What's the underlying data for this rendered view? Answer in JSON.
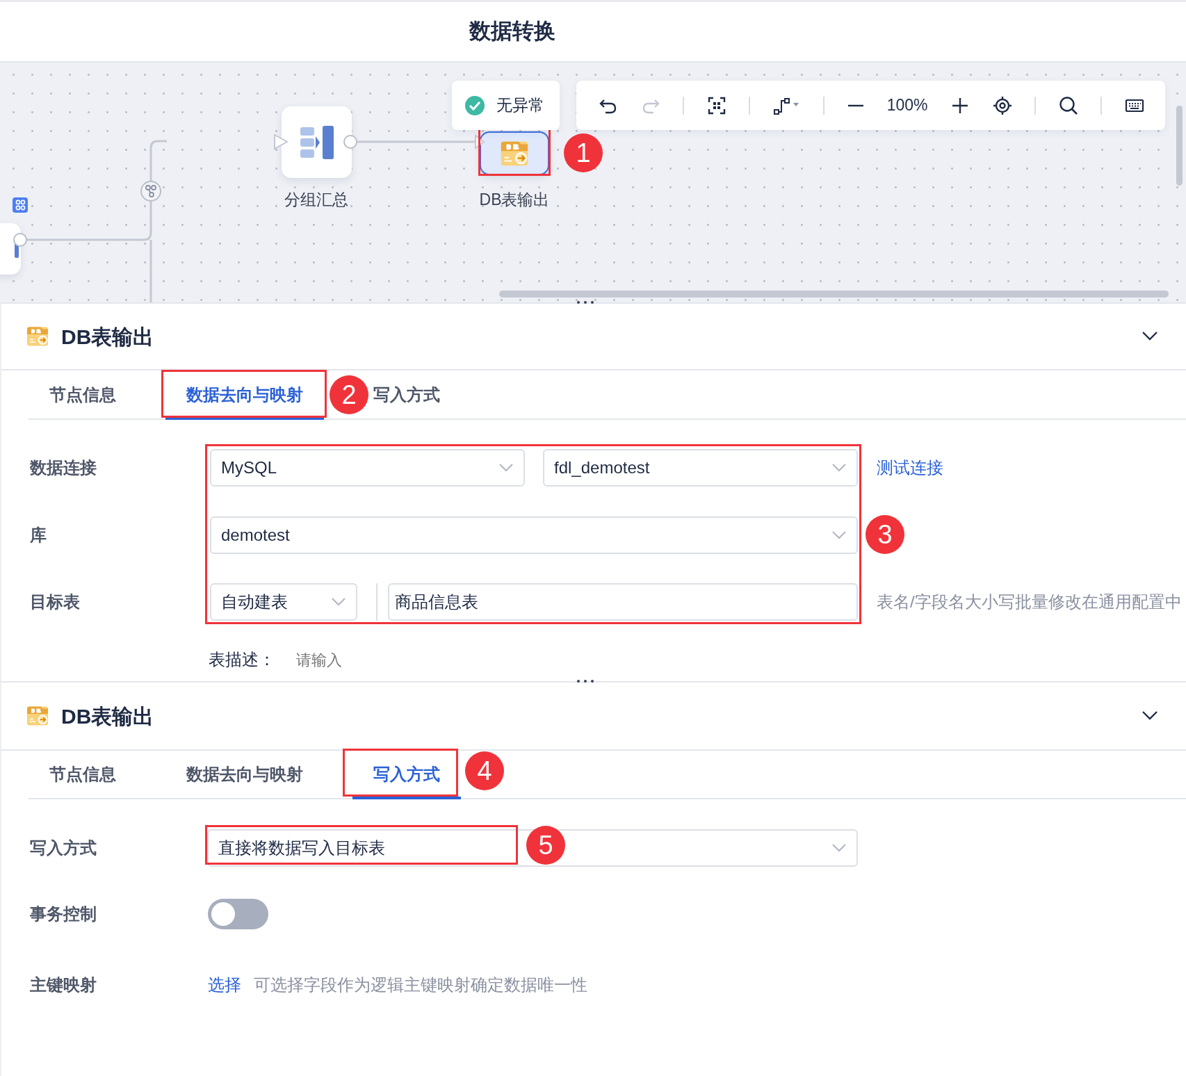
{
  "title": "数据转换",
  "canvas": {
    "status": {
      "label": "无异常",
      "ok": true
    },
    "toolbar": {
      "zoom": "100%",
      "undo_disabled": false,
      "redo_disabled": true
    },
    "nodes": [
      {
        "kind": "partial",
        "selected": false
      },
      {
        "kind": "group",
        "label": "分组汇总",
        "selected": false
      },
      {
        "kind": "db",
        "label": "DB表输出",
        "selected": true
      }
    ]
  },
  "panels": [
    {
      "title": "DB表输出",
      "expanded": true,
      "tabs": [
        {
          "label": "节点信息",
          "selected": false
        },
        {
          "label": "数据去向与映射",
          "selected": true
        },
        {
          "label": "写入方式",
          "selected": false
        }
      ],
      "rows": [
        {
          "kind": "connection",
          "label": "数据连接",
          "selects": [
            "MySQL",
            "fdl_demotest"
          ],
          "link": "测试连接"
        },
        {
          "kind": "select",
          "label": "库",
          "value": "demotest"
        },
        {
          "kind": "target",
          "label": "目标表",
          "mode": "自动建表",
          "value": "商品信息表",
          "hint": "表名/字段名大小写批量修改在通用配置中"
        },
        {
          "kind": "description",
          "label": "表描述：",
          "placeholder": "请输入"
        }
      ]
    },
    {
      "title": "DB表输出",
      "expanded": true,
      "tabs": [
        {
          "label": "节点信息",
          "selected": false
        },
        {
          "label": "数据去向与映射",
          "selected": false
        },
        {
          "label": "写入方式",
          "selected": true
        }
      ],
      "rows": [
        {
          "kind": "select",
          "label": "写入方式",
          "value": "直接将数据写入目标表"
        },
        {
          "kind": "toggle",
          "label": "事务控制",
          "on": false
        },
        {
          "kind": "link",
          "label": "主键映射",
          "link": "选择",
          "hint": "可选择字段作为逻辑主键映射确定数据唯一性"
        }
      ]
    }
  ],
  "annotations": [
    {
      "label": "1"
    },
    {
      "label": "2"
    },
    {
      "label": "3"
    },
    {
      "label": "4"
    },
    {
      "label": "5"
    }
  ]
}
